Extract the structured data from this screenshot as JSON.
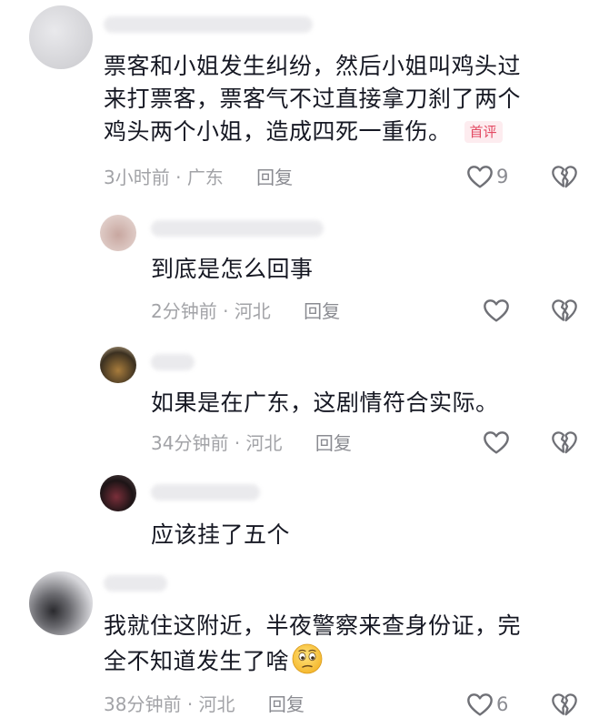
{
  "comments": [
    {
      "text_lines": [
        "票客和小姐发生纠纷，然后小姐叫鸡头过",
        "来打票客，票客气不过直接拿刀刹了两个",
        "鸡头两个小姐，造成四死一重伤。"
      ],
      "badge": "首评",
      "time": "3小时前",
      "location": "广东",
      "reply_label": "回复",
      "like_count": "9"
    },
    {
      "text_lines": [
        "到底是怎么回事"
      ],
      "time": "2分钟前",
      "location": "河北",
      "reply_label": "回复"
    },
    {
      "text_lines": [
        "如果是在广东，这剧情符合实际。"
      ],
      "time": "34分钟前",
      "location": "河北",
      "reply_label": "回复"
    },
    {
      "text_lines": [
        "应该挂了五个"
      ]
    },
    {
      "text_lines": [
        "我就住这附近，半夜警察来查身份证，完",
        "全不知道发生了啥"
      ],
      "time": "38分钟前",
      "location": "河北",
      "reply_label": "回复",
      "like_count": "6"
    }
  ],
  "meta_separator": "·",
  "icons": {
    "like": "heart-outline-icon",
    "dislike": "broken-heart-icon",
    "emoji": "confused-face-emoji-icon"
  },
  "colors": {
    "text": "#161823",
    "meta": "#a2a3a7",
    "badge_text": "#e34a63",
    "badge_bg": "#fdecef"
  }
}
